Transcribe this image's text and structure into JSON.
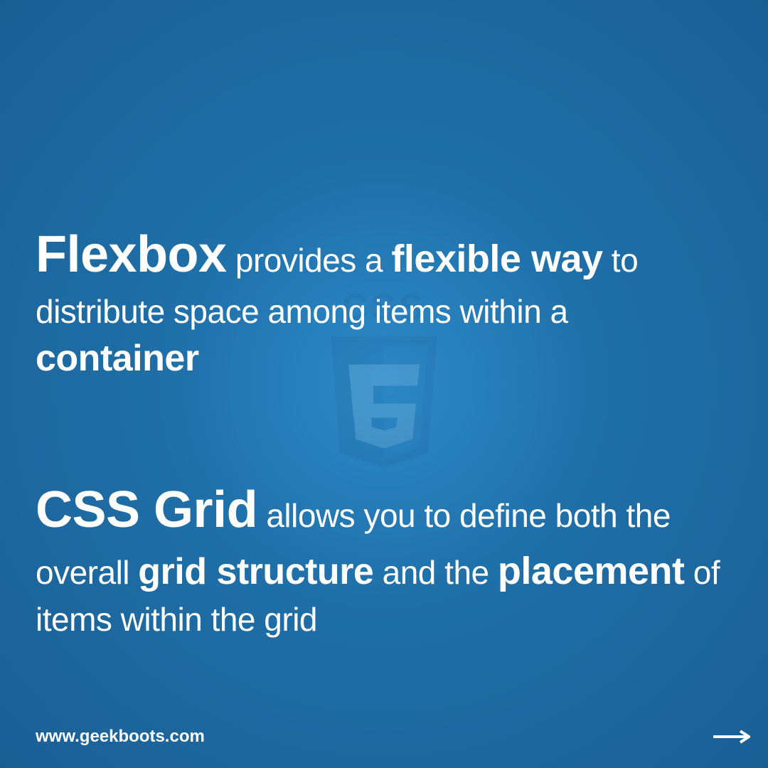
{
  "watermark": {
    "label": "CSS"
  },
  "paragraphs": {
    "p1": {
      "s1_bold_large": "Flexbox",
      "s2": " provides a ",
      "s3_bold": "flexible way",
      "s4": " to distribute space among items within a ",
      "s5_bold": "container"
    },
    "p2": {
      "s1_bold_large": "CSS Grid",
      "s2": " allows you to define both the overall ",
      "s3_bold": "grid structure",
      "s4": " and the ",
      "s5_bold": "placement",
      "s6": " of items within the grid"
    }
  },
  "footer": {
    "url": "www.geekboots.com"
  }
}
